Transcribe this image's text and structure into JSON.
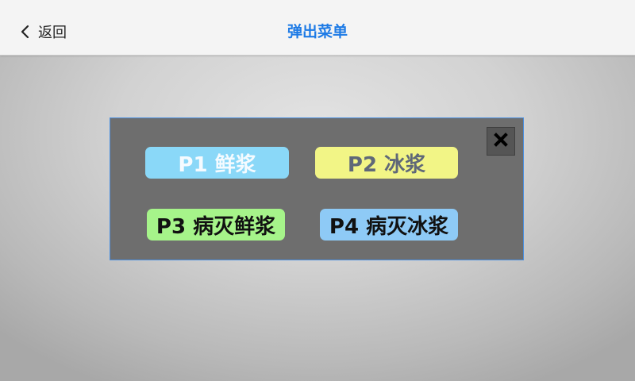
{
  "header": {
    "back_label": "返回",
    "title": "弹出菜单",
    "title_color": "#1e7be6"
  },
  "dialog": {
    "close_icon": "close-icon",
    "options": [
      {
        "label": "P1 鲜浆",
        "bg": "#8ad8f8"
      },
      {
        "label": "P2 冰浆",
        "bg": "#f2f586"
      },
      {
        "label": "P3 病灭鲜浆",
        "bg": "#a6f48a"
      },
      {
        "label": "P4 病灭冰浆",
        "bg": "#8ecaf6"
      }
    ]
  }
}
